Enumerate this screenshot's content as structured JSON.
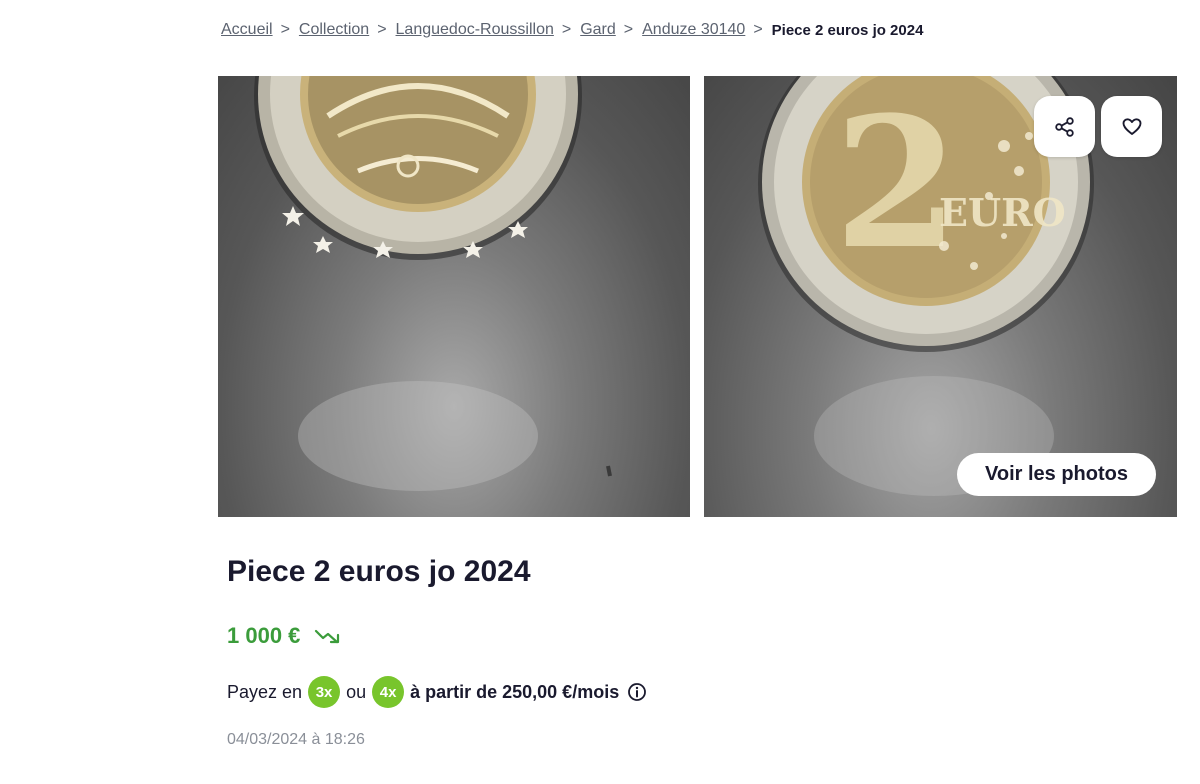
{
  "breadcrumb": {
    "links": [
      "Accueil",
      "Collection",
      "Languedoc-Roussillon",
      "Gard",
      "Anduze 30140"
    ],
    "separator": ">",
    "current": "Piece 2 euros jo 2024"
  },
  "gallery": {
    "photo_left_alt": "Photo 1",
    "photo_right_alt": "Photo 2",
    "share_icon": "share-icon",
    "favorite_icon": "heart-icon",
    "view_photos_label": "Voir les photos"
  },
  "listing": {
    "title": "Piece 2 euros jo 2024",
    "price": "1 000 €",
    "price_trend_icon": "trend-down-icon",
    "price_color": "#3b9c3b",
    "payment": {
      "prefix": "Payez en",
      "option_3x": "3x",
      "connector": "ou",
      "option_4x": "4x",
      "amount_text": "à partir de 250,00 €/mois",
      "badge_color": "#78c52c",
      "info_icon": "info-icon"
    },
    "date": "04/03/2024 à 18:26"
  }
}
